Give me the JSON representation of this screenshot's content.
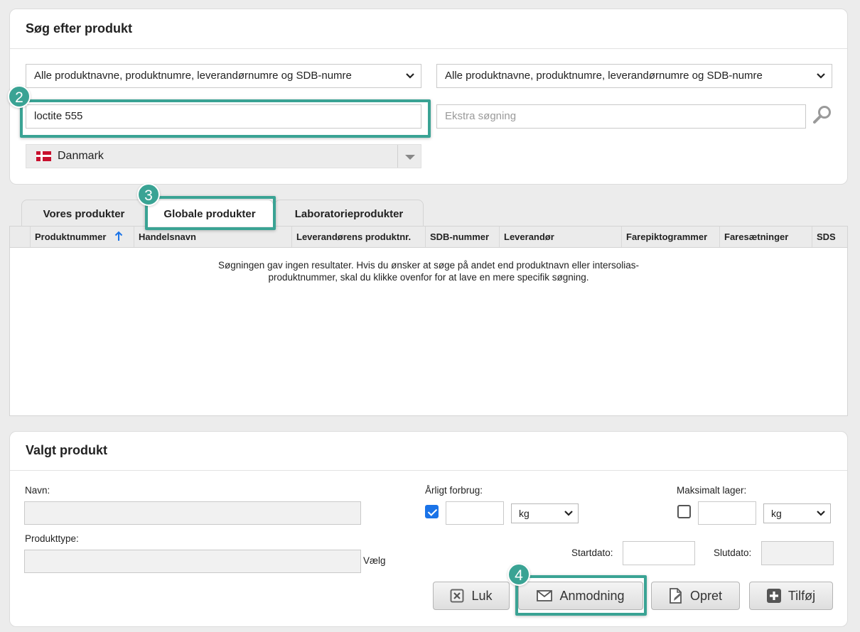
{
  "search": {
    "title": "Søg efter produkt",
    "scope_left": "Alle produktnavne, produktnumre, leverandørnumre og SDB-numre",
    "scope_right": "Alle produktnavne, produktnumre, leverandørnumre og SDB-numre",
    "query_value": "loctite 555",
    "extra_placeholder": "Ekstra søgning",
    "country": "Danmark"
  },
  "annotations": {
    "badge_2": "2",
    "badge_3": "3",
    "badge_4": "4"
  },
  "tabs": [
    {
      "label": "Vores produkter"
    },
    {
      "label": "Globale produkter"
    },
    {
      "label": "Laboratorieprodukter"
    }
  ],
  "table": {
    "columns": [
      "Produktnummer",
      "Handelsnavn",
      "Leverandørens produktnr.",
      "SDB-nummer",
      "Leverandør",
      "Farepiktogrammer",
      "Faresætninger",
      "SDS"
    ],
    "empty_line1": "Søgningen gav ingen resultater. Hvis du ønsker at søge på andet end produktnavn eller intersolias-",
    "empty_line2": "produktnummer, skal du klikke ovenfor for at lave en mere specifik søgning."
  },
  "selected": {
    "title": "Valgt produkt",
    "name_label": "Navn:",
    "type_label": "Produkttype:",
    "choose_label": "Vælg",
    "yearly_label": "Årligt forbrug:",
    "yearly_unit": "kg",
    "yearly_checked": true,
    "max_label": "Maksimalt lager:",
    "max_unit": "kg",
    "max_checked": false,
    "start_label": "Startdato:",
    "end_label": "Slutdato:"
  },
  "buttons": {
    "close": "Luk",
    "request": "Anmodning",
    "create": "Opret",
    "add": "Tilføj"
  },
  "colors": {
    "highlight": "#3aa394",
    "sort_arrow": "#1a73e8"
  }
}
